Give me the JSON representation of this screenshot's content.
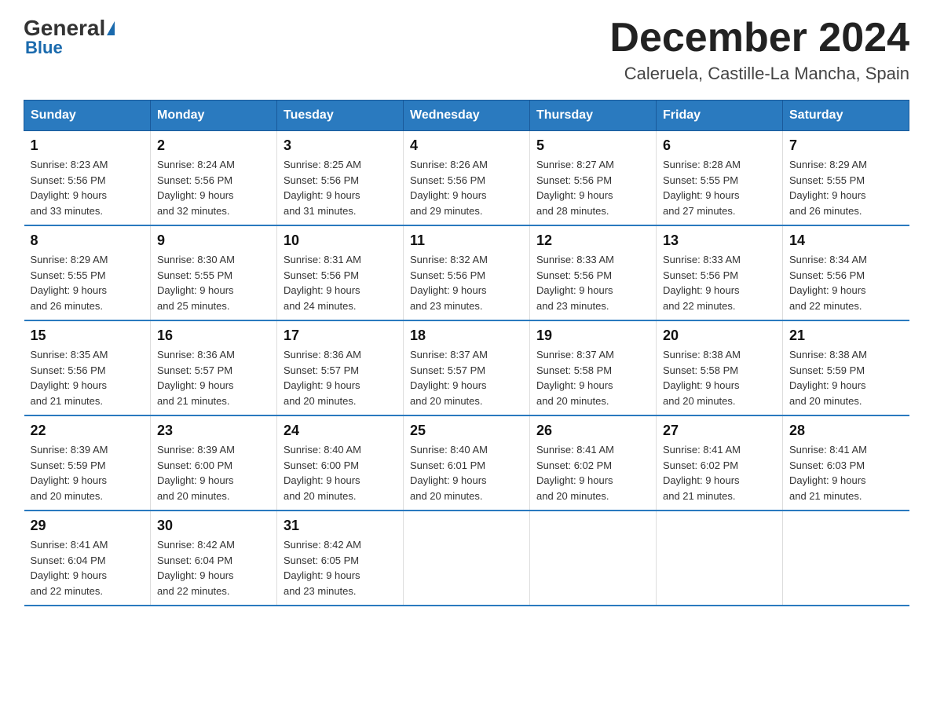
{
  "header": {
    "logo": {
      "general": "General",
      "blue": "Blue",
      "underline": "Blue"
    },
    "title": "December 2024",
    "location": "Caleruela, Castille-La Mancha, Spain"
  },
  "days_of_week": [
    "Sunday",
    "Monday",
    "Tuesday",
    "Wednesday",
    "Thursday",
    "Friday",
    "Saturday"
  ],
  "weeks": [
    [
      {
        "day": "1",
        "sunrise": "8:23 AM",
        "sunset": "5:56 PM",
        "daylight": "9 hours and 33 minutes."
      },
      {
        "day": "2",
        "sunrise": "8:24 AM",
        "sunset": "5:56 PM",
        "daylight": "9 hours and 32 minutes."
      },
      {
        "day": "3",
        "sunrise": "8:25 AM",
        "sunset": "5:56 PM",
        "daylight": "9 hours and 31 minutes."
      },
      {
        "day": "4",
        "sunrise": "8:26 AM",
        "sunset": "5:56 PM",
        "daylight": "9 hours and 29 minutes."
      },
      {
        "day": "5",
        "sunrise": "8:27 AM",
        "sunset": "5:56 PM",
        "daylight": "9 hours and 28 minutes."
      },
      {
        "day": "6",
        "sunrise": "8:28 AM",
        "sunset": "5:55 PM",
        "daylight": "9 hours and 27 minutes."
      },
      {
        "day": "7",
        "sunrise": "8:29 AM",
        "sunset": "5:55 PM",
        "daylight": "9 hours and 26 minutes."
      }
    ],
    [
      {
        "day": "8",
        "sunrise": "8:29 AM",
        "sunset": "5:55 PM",
        "daylight": "9 hours and 26 minutes."
      },
      {
        "day": "9",
        "sunrise": "8:30 AM",
        "sunset": "5:55 PM",
        "daylight": "9 hours and 25 minutes."
      },
      {
        "day": "10",
        "sunrise": "8:31 AM",
        "sunset": "5:56 PM",
        "daylight": "9 hours and 24 minutes."
      },
      {
        "day": "11",
        "sunrise": "8:32 AM",
        "sunset": "5:56 PM",
        "daylight": "9 hours and 23 minutes."
      },
      {
        "day": "12",
        "sunrise": "8:33 AM",
        "sunset": "5:56 PM",
        "daylight": "9 hours and 23 minutes."
      },
      {
        "day": "13",
        "sunrise": "8:33 AM",
        "sunset": "5:56 PM",
        "daylight": "9 hours and 22 minutes."
      },
      {
        "day": "14",
        "sunrise": "8:34 AM",
        "sunset": "5:56 PM",
        "daylight": "9 hours and 22 minutes."
      }
    ],
    [
      {
        "day": "15",
        "sunrise": "8:35 AM",
        "sunset": "5:56 PM",
        "daylight": "9 hours and 21 minutes."
      },
      {
        "day": "16",
        "sunrise": "8:36 AM",
        "sunset": "5:57 PM",
        "daylight": "9 hours and 21 minutes."
      },
      {
        "day": "17",
        "sunrise": "8:36 AM",
        "sunset": "5:57 PM",
        "daylight": "9 hours and 20 minutes."
      },
      {
        "day": "18",
        "sunrise": "8:37 AM",
        "sunset": "5:57 PM",
        "daylight": "9 hours and 20 minutes."
      },
      {
        "day": "19",
        "sunrise": "8:37 AM",
        "sunset": "5:58 PM",
        "daylight": "9 hours and 20 minutes."
      },
      {
        "day": "20",
        "sunrise": "8:38 AM",
        "sunset": "5:58 PM",
        "daylight": "9 hours and 20 minutes."
      },
      {
        "day": "21",
        "sunrise": "8:38 AM",
        "sunset": "5:59 PM",
        "daylight": "9 hours and 20 minutes."
      }
    ],
    [
      {
        "day": "22",
        "sunrise": "8:39 AM",
        "sunset": "5:59 PM",
        "daylight": "9 hours and 20 minutes."
      },
      {
        "day": "23",
        "sunrise": "8:39 AM",
        "sunset": "6:00 PM",
        "daylight": "9 hours and 20 minutes."
      },
      {
        "day": "24",
        "sunrise": "8:40 AM",
        "sunset": "6:00 PM",
        "daylight": "9 hours and 20 minutes."
      },
      {
        "day": "25",
        "sunrise": "8:40 AM",
        "sunset": "6:01 PM",
        "daylight": "9 hours and 20 minutes."
      },
      {
        "day": "26",
        "sunrise": "8:41 AM",
        "sunset": "6:02 PM",
        "daylight": "9 hours and 20 minutes."
      },
      {
        "day": "27",
        "sunrise": "8:41 AM",
        "sunset": "6:02 PM",
        "daylight": "9 hours and 21 minutes."
      },
      {
        "day": "28",
        "sunrise": "8:41 AM",
        "sunset": "6:03 PM",
        "daylight": "9 hours and 21 minutes."
      }
    ],
    [
      {
        "day": "29",
        "sunrise": "8:41 AM",
        "sunset": "6:04 PM",
        "daylight": "9 hours and 22 minutes."
      },
      {
        "day": "30",
        "sunrise": "8:42 AM",
        "sunset": "6:04 PM",
        "daylight": "9 hours and 22 minutes."
      },
      {
        "day": "31",
        "sunrise": "8:42 AM",
        "sunset": "6:05 PM",
        "daylight": "9 hours and 23 minutes."
      },
      null,
      null,
      null,
      null
    ]
  ],
  "labels": {
    "sunrise": "Sunrise:",
    "sunset": "Sunset:",
    "daylight": "Daylight:"
  },
  "colors": {
    "header_bg": "#2a7abf",
    "accent": "#1a6aad"
  }
}
